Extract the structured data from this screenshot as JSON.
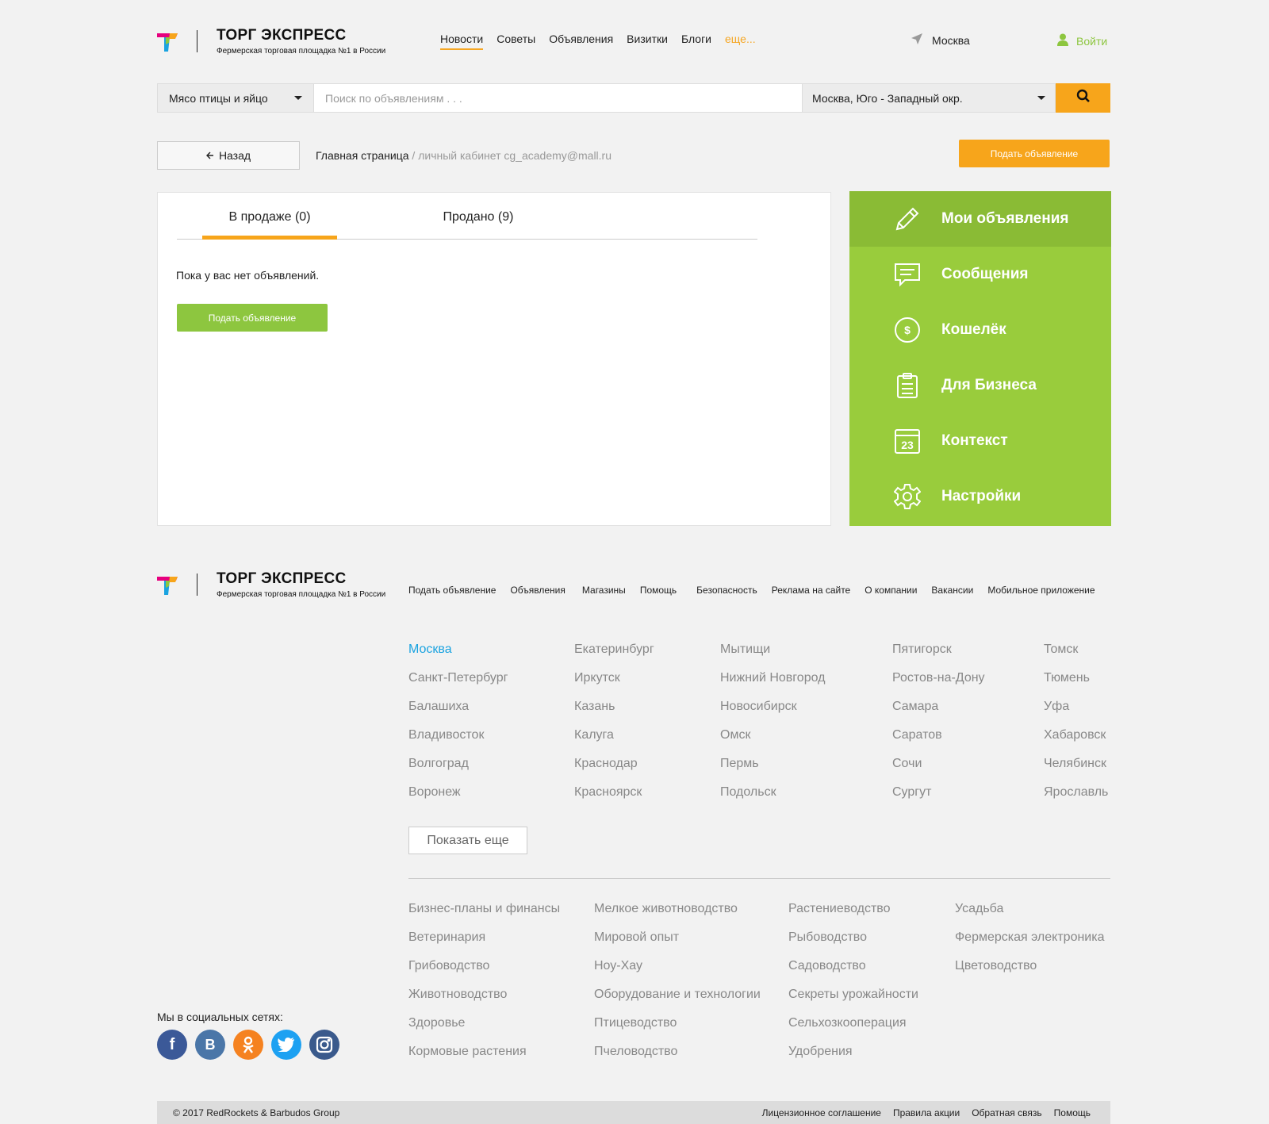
{
  "brand": {
    "title": "ТОРГ ЭКСПРЕСС",
    "subtitle": "Фермерская торговая площадка №1 в России"
  },
  "header": {
    "nav": [
      "Новости",
      "Советы",
      "Объявления",
      "Визитки",
      "Блоги",
      "еще..."
    ],
    "city": "Москва",
    "login": "Войти"
  },
  "search": {
    "category": "Мясо птицы и яйцо",
    "placeholder": "Поиск по объявлениям . . .",
    "region": "Москва, Юго - Западный окр."
  },
  "breadcrumb": {
    "back": "Назад",
    "home": "Главная страница",
    "current": "/ личный кабинет cg_academy@mall.ru"
  },
  "post_ad_label": "Подать объявление",
  "cabinet": {
    "tabs": [
      "В продаже (0)",
      "Продано (9)"
    ],
    "empty_text": "Пока у вас нет объявлений.",
    "post_label": "Подать объявление"
  },
  "side_menu": [
    {
      "label": "Мои объявления",
      "icon": "pencil-icon"
    },
    {
      "label": "Сообщения",
      "icon": "message-icon"
    },
    {
      "label": "Кошелёк",
      "icon": "wallet-dollar-icon"
    },
    {
      "label": "Для Бизнеса",
      "icon": "clipboard-icon"
    },
    {
      "label": "Контекст",
      "icon": "calendar-icon"
    },
    {
      "label": "Настройки",
      "icon": "gear-icon"
    }
  ],
  "calendar_day": "23",
  "footer": {
    "nav": [
      "Подать объявление",
      "Объявления",
      "Магазины",
      "Помощь",
      "Безопасность",
      "Реклама на сайте",
      "О компании",
      "Вакансии",
      "Мобильное приложение"
    ],
    "cities": [
      [
        "Москва",
        "Санкт-Петербург",
        "Балашиха",
        "Владивосток",
        "Волгоград",
        "Воронеж"
      ],
      [
        "Екатеринбург",
        "Иркутск",
        "Казань",
        "Калуга",
        "Краснодар",
        "Красноярск"
      ],
      [
        "Мытищи",
        "Нижний Новгород",
        "Новосибирск",
        "Омск",
        "Пермь",
        "Подольск"
      ],
      [
        "Пятигорск",
        "Ростов-на-Дону",
        "Самара",
        "Саратов",
        "Сочи",
        "Сургут"
      ],
      [
        "Томск",
        "Тюмень",
        "Уфа",
        "Хабаровск",
        "Челябинск",
        "Ярославль"
      ]
    ],
    "show_more": "Показать еще",
    "categories": [
      [
        "Бизнес-планы и финансы",
        "Ветеринария",
        "Грибоводство",
        "Животноводство",
        "Здоровье",
        "Кормовые растения"
      ],
      [
        "Мелкое животноводство",
        "Мировой опыт",
        "Ноу-Хау",
        "Оборудование и технологии",
        "Птицеводство",
        "Пчеловодство"
      ],
      [
        "Растениеводство",
        "Рыбоводство",
        "Садоводство",
        "Секреты урожайности",
        "Сельхозкооперация",
        "Удобрения"
      ],
      [
        "Усадьба",
        "Фермерская электроника",
        "Цветоводство"
      ]
    ],
    "social_title": "Мы в социальных сетях:",
    "copyright": "© 2017 RedRockets & Barbudos Group",
    "bottom_links": [
      "Лицензионное соглашение",
      "Правила акции",
      "Обратная связь",
      "Помощь"
    ]
  },
  "colors": {
    "accent": "#f7a51b",
    "green": "#99cc3c",
    "link_blue": "#1aa3e0"
  }
}
